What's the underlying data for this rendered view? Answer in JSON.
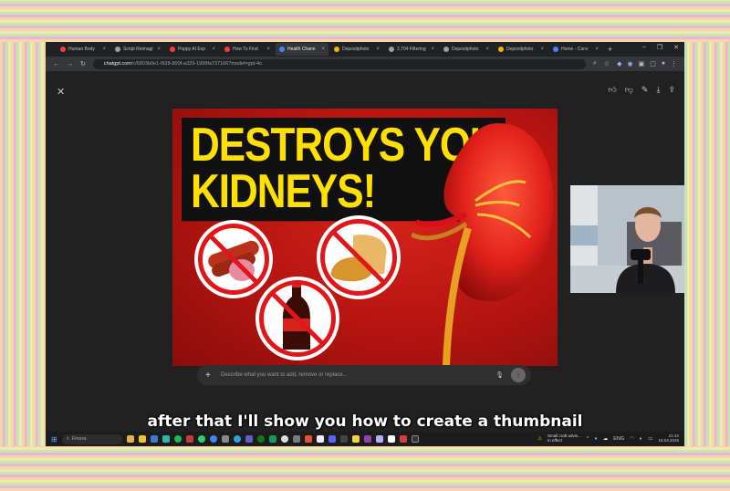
{
  "browser": {
    "tabs": [
      {
        "label": "Human Body",
        "color": "#ff3b30"
      },
      {
        "label": "Script Reimagi",
        "color": "#9aa0a6"
      },
      {
        "label": "Poppy AI Exp",
        "color": "#ff3b30"
      },
      {
        "label": "How To Find",
        "color": "#ff3b30"
      },
      {
        "label": "Health Chann",
        "color": "#4285f4"
      },
      {
        "label": "Depositphoto",
        "color": "#f4b400"
      },
      {
        "label": "2,704 Filtering",
        "color": "#9aa0a6"
      },
      {
        "label": "Depositphoto",
        "color": "#9aa0a6"
      },
      {
        "label": "Depositphoto",
        "color": "#f4b400"
      },
      {
        "label": "Home - Canv",
        "color": "#4285f4"
      }
    ],
    "active_tab_index": 4,
    "url_host": "chatgpt.com",
    "url_path": "/c/6803b0e1-f928-800f-a329-1999fa737166?model=gpt-4o"
  },
  "chat": {
    "prompt_placeholder": "Describe what you want to add, remove or replace...",
    "image_headline_line1": "DESTROYS YOU",
    "image_headline_line2": "KIDNEYS!"
  },
  "taskbar": {
    "search_label": "Finora",
    "weather_line1": "Small craft advis...",
    "weather_line2": "In effect",
    "language": "ENG",
    "time": "21:42",
    "date": "18.04.2025"
  },
  "caption": "after that I'll show you how to create a thumbnail"
}
